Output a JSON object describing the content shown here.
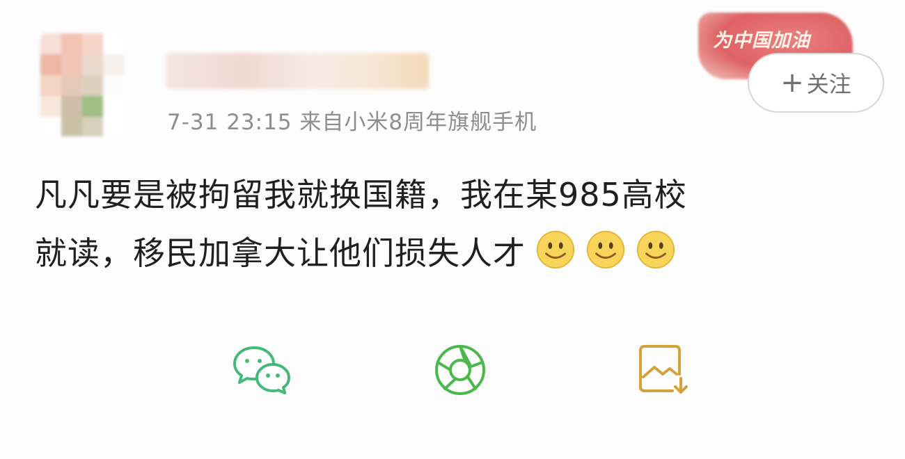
{
  "post": {
    "meta": "7-31 23:15  来自小米8周年旗舰手机",
    "content_line1": "凡凡要是被拘留我就换国籍，我在某985高校",
    "content_line2": "就读，移民加拿大让他们损失人才"
  },
  "badge": {
    "text": "为中国加油"
  },
  "follow": {
    "plus": "+",
    "label": "关注"
  },
  "emojis": [
    "smile-icon",
    "smile-icon",
    "smile-icon"
  ],
  "share": [
    {
      "name": "wechat-icon",
      "color": "#3cb371"
    },
    {
      "name": "moments-icon",
      "color": "#4bb84b"
    },
    {
      "name": "save-image-icon",
      "color": "#d6a13a"
    }
  ],
  "colors": {
    "text": "#1f1f1f",
    "meta": "#8e8e8e",
    "badge": "#d9474a"
  }
}
